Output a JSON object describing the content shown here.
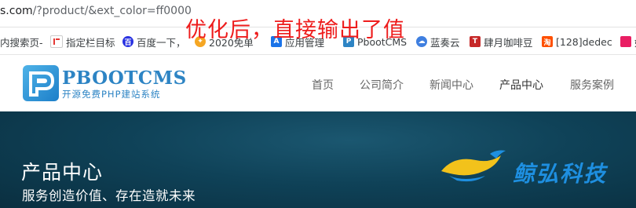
{
  "address_bar": {
    "host": "s.com",
    "path": "/?product/&ext_color=ff0000"
  },
  "bookmarks": [
    {
      "label": "内搜索页-",
      "icon": "page-icon",
      "color": "#ffffff"
    },
    {
      "label": "指定栏目标",
      "icon": "bookmark-icon",
      "color": "#e53935"
    },
    {
      "label": "百度一下，",
      "icon": "baidu-icon",
      "color": "#2932e1"
    },
    {
      "label": "2020免单",
      "icon": "badge-icon",
      "color": "#f5a623"
    },
    {
      "label": "应用管理",
      "icon": "app-icon",
      "color": "#1a73e8"
    },
    {
      "label": "PbootCMS",
      "icon": "pboot-icon",
      "color": "#2d84c4"
    },
    {
      "label": "蓝奏云",
      "icon": "cloud-icon",
      "color": "#3f7fe0"
    },
    {
      "label": "肆月咖啡豆",
      "icon": "t-icon",
      "color": "#c62828"
    },
    {
      "label": "[128]dedec",
      "icon": "taobao-icon",
      "color": "#ff5000"
    },
    {
      "label": "妙",
      "icon": "pink-icon",
      "color": "#e91e63"
    }
  ],
  "annotation": {
    "text": "优化后，直接输出了值",
    "color": "#ee1c1c"
  },
  "site": {
    "logo_title": "PBOOTCMS",
    "logo_subtitle": "开源免费PHP建站系统",
    "brand_color": "#2d84c4",
    "nav": [
      "首页",
      "公司简介",
      "新闻中心",
      "产品中心",
      "服务案例"
    ],
    "nav_active": "产品中心"
  },
  "banner": {
    "title": "产品中心",
    "subtitle": "服务创造价值、存在造就未来",
    "logo_text": "鲸弘科技"
  }
}
